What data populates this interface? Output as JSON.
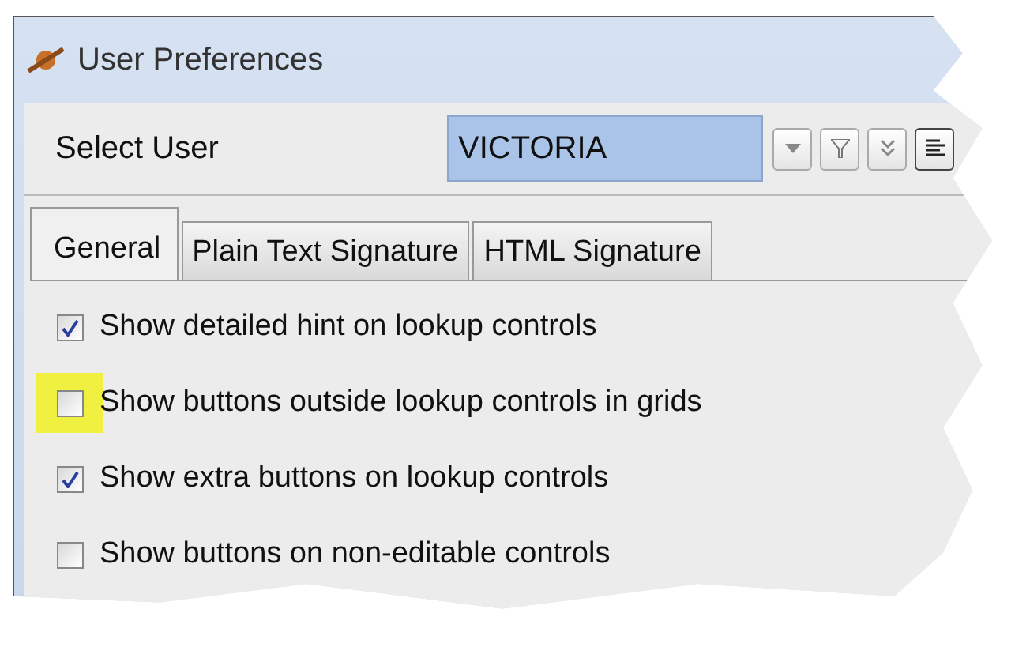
{
  "window": {
    "title": "User Preferences"
  },
  "select_user": {
    "label": "Select User",
    "value": "VICTORIA"
  },
  "tabs": [
    {
      "label": "General",
      "selected": true
    },
    {
      "label": "Plain Text Signature",
      "selected": false
    },
    {
      "label": "HTML Signature",
      "selected": false
    }
  ],
  "options": [
    {
      "label": "Show detailed hint on lookup controls",
      "checked": true,
      "highlighted": false
    },
    {
      "label": "Show buttons outside lookup controls in grids",
      "checked": false,
      "highlighted": true
    },
    {
      "label": "Show extra buttons on lookup controls",
      "checked": true,
      "highlighted": false
    },
    {
      "label": "Show buttons on non-editable controls",
      "checked": false,
      "highlighted": false
    }
  ]
}
